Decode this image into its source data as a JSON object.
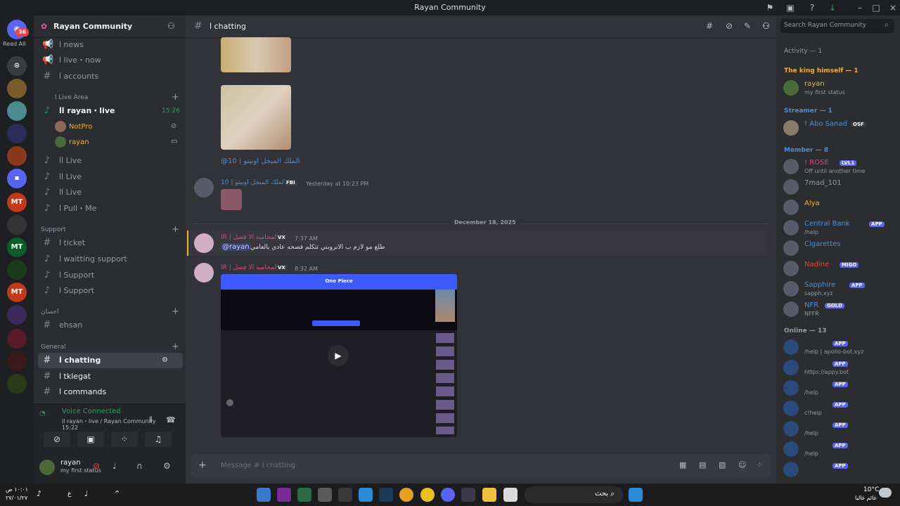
{
  "window": {
    "title": "Rayan Community",
    "read_all": "Read All",
    "notif": "36"
  },
  "server": {
    "name": "Rayan Community"
  },
  "channels": [
    {
      "name": "ا news"
    },
    {
      "name": "ا live・now"
    },
    {
      "name": "ا accounts"
    }
  ],
  "live_area": {
    "label": "ا Live Area",
    "voice_channel": "اا rayan・live",
    "time": "15:26",
    "users": [
      "NotPro",
      "rayan"
    ]
  },
  "voice_channels": [
    "اا Live",
    "اا Live",
    "اا Live",
    "ا Pull・Me"
  ],
  "support": {
    "label": "Support",
    "items": [
      "ا ticket",
      "ا waitting support",
      "ا Support",
      "ا Support"
    ]
  },
  "ehsan": {
    "label": "احسان",
    "item": "ehsan"
  },
  "general": {
    "label": "General",
    "items": [
      "ا chatting",
      "ا tklegat",
      "ا commands"
    ]
  },
  "voice": {
    "status": "Voice Connected",
    "channel": "اا rayan・live / Rayan Community",
    "time": "15:22"
  },
  "user": {
    "name": "rayan",
    "status": "my first status"
  },
  "chat": {
    "channel": "ا chatting",
    "search_placeholder": "Search Rayan Community",
    "reply_link": "@الملك المبجل اوبيتو | 10",
    "msg1": {
      "author": "10 | الملك المبجل اوبيتو",
      "tag": "FBI",
      "time": "Yesterday at 10:23 PM"
    },
    "date_div": "December 18, 2025",
    "msg2": {
      "author": "IR | المحاميه الا فضل",
      "tag": "VX",
      "time": "7:37 AM",
      "mention": "@rayan",
      "text": "طلع مو لازم ب الانروبتي تتكلم فصحه عادي يالعامي"
    },
    "msg3": {
      "author": "IR | المحاميه الا فضل",
      "tag": "VX",
      "time": "8:32 AM",
      "video_title": "One Piece"
    },
    "composer": "Message # ا chatting"
  },
  "members": {
    "activity": "Activity — 1",
    "king_header": "The king himself — 1",
    "king": {
      "name": "rayan",
      "status": "my first status"
    },
    "streamer_header": "Streamer — 1",
    "streamer": {
      "name": "! Abo Sanad",
      "tag": "OSF"
    },
    "member_header": "Member — 8",
    "list": [
      {
        "name": "! ROSE",
        "tag": "LVL1",
        "status": "Off until another time",
        "color": "#e0457b"
      },
      {
        "name": "7mad_101",
        "tag": "",
        "status": "",
        "color": "#949ba4"
      },
      {
        "name": "Alya",
        "tag": "",
        "status": "",
        "color": "#f0b232"
      },
      {
        "name": "Central Bank",
        "tag": "APP",
        "status": "/help",
        "color": "#4d8fd6"
      },
      {
        "name": "Cigarettes",
        "tag": "",
        "status": "",
        "color": "#4d8fd6"
      },
      {
        "name": "Nadine",
        "tag": "MIGO",
        "status": "",
        "color": "#f23f43"
      },
      {
        "name": "Sapphire",
        "tag": "APP",
        "status": "sapph.xyz",
        "color": "#4d8fd6"
      },
      {
        "name": "NFR",
        "tag": "GOLD",
        "status": "NFFR",
        "color": "#4d8fd6"
      }
    ],
    "online_header": "Online — 13",
    "online": [
      {
        "status": "/help | apollo-bot.xyz"
      },
      {
        "status": "https://appy.bot"
      },
      {
        "status": "/help"
      },
      {
        "status": "c!help"
      },
      {
        "status": "/help"
      },
      {
        "status": "/help"
      },
      {
        "status": ""
      }
    ],
    "app_tag": "APP"
  },
  "taskbar": {
    "time": "١٠:٠١ ص",
    "date": "٢٧/٠١/٢٧",
    "search": "بحث",
    "weather": "10°C",
    "weather_desc": "غائم غالبا",
    "lang": "ع"
  }
}
